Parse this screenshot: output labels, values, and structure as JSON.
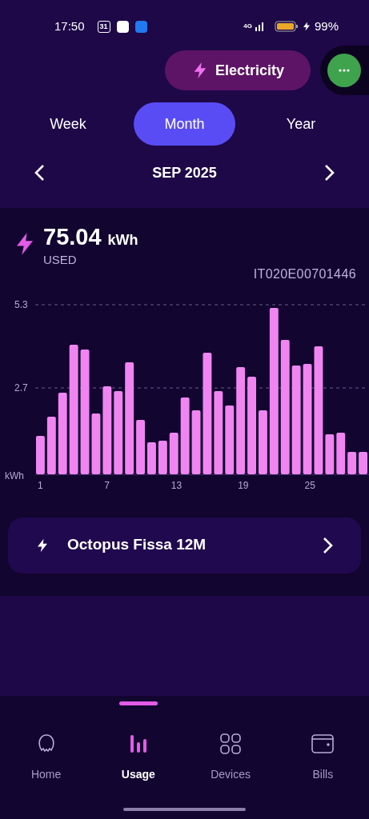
{
  "status_bar": {
    "time": "17:50",
    "calendar_day": "31",
    "network": "4G",
    "battery": "99%"
  },
  "fuel_switch": {
    "label": "Electricity"
  },
  "period_tabs": [
    {
      "label": "Week",
      "selected": false
    },
    {
      "label": "Month",
      "selected": true
    },
    {
      "label": "Year",
      "selected": false
    }
  ],
  "period": {
    "label": "SEP 2025"
  },
  "summary": {
    "value": "75.04",
    "unit": "kWh",
    "caption": "USED",
    "meter_id": "IT020E00701446"
  },
  "chart_data": {
    "type": "bar",
    "ylabel": "kWh",
    "x": [
      1,
      2,
      3,
      4,
      5,
      6,
      7,
      8,
      9,
      10,
      11,
      12,
      13,
      14,
      15,
      16,
      17,
      18,
      19,
      20,
      21,
      22,
      23,
      24,
      25,
      26,
      27,
      28,
      29,
      30
    ],
    "values": [
      1.2,
      1.8,
      2.55,
      4.05,
      3.9,
      1.9,
      2.75,
      2.6,
      3.5,
      1.7,
      1.0,
      1.05,
      1.3,
      2.4,
      2.0,
      3.8,
      2.6,
      2.15,
      3.35,
      3.05,
      2.0,
      5.2,
      4.2,
      3.4,
      3.45,
      4.0,
      1.25,
      1.3,
      0.7,
      0.7
    ],
    "xlim": [
      0.5,
      30.5
    ],
    "ylim": [
      0,
      5.3
    ],
    "ref_lines": [
      {
        "axis": "y",
        "value": 2.7
      },
      {
        "axis": "y",
        "value": 5.3
      }
    ],
    "yticks": [
      2.7,
      5.3
    ],
    "xticks": [
      1,
      7,
      13,
      19,
      25
    ]
  },
  "tariff": {
    "label": "Octopus Fissa 12M"
  },
  "nav": [
    {
      "label": "Home",
      "kind": "home",
      "selected": false
    },
    {
      "label": "Usage",
      "kind": "usage",
      "selected": true
    },
    {
      "label": "Devices",
      "kind": "devices",
      "selected": false
    },
    {
      "label": "Bills",
      "kind": "bills",
      "selected": false
    }
  ]
}
